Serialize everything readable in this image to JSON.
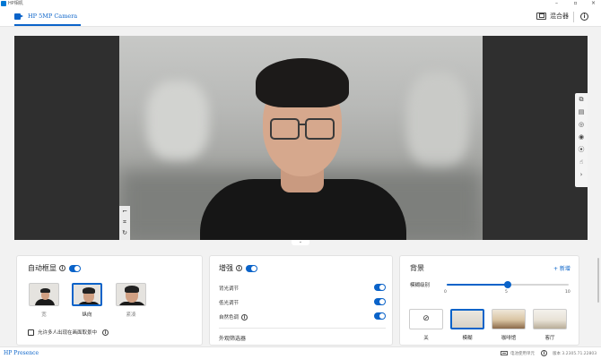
{
  "window": {
    "title": "HP相机"
  },
  "header": {
    "camera_tab": "HP 5MP Camera",
    "mixer_label": "混合器"
  },
  "preview": {
    "left_tools": [
      "⌐",
      "⌗",
      "↻"
    ],
    "right_tools": [
      "⧉",
      "▤",
      "◎",
      "◉",
      "⦿",
      "☝",
      "›"
    ]
  },
  "autoframe": {
    "title": "自动框显",
    "enabled": true,
    "options": [
      {
        "label": "宽",
        "selected": false
      },
      {
        "label": "纵向",
        "selected": true
      },
      {
        "label": "紧凑",
        "selected": false
      }
    ],
    "checkbox_label": "允许多人出现在画面取景中"
  },
  "enhance": {
    "title": "增强",
    "enabled": true,
    "rows": [
      {
        "label": "背光调节",
        "on": true
      },
      {
        "label": "低光调节",
        "on": true
      },
      {
        "label": "自然色调",
        "on": true,
        "info": true
      }
    ],
    "filter_label": "外观筛选器"
  },
  "background": {
    "title": "背景",
    "add_label": "+ 新增",
    "blur_label": "模糊级别",
    "slider": {
      "min": "0",
      "mid": "5",
      "max": "10",
      "value": 5
    },
    "options": [
      {
        "label": "关",
        "selected": false
      },
      {
        "label": "模糊",
        "selected": true
      },
      {
        "label": "咖啡馆",
        "selected": false
      },
      {
        "label": "客厅",
        "selected": false
      }
    ]
  },
  "status": {
    "brand": "HP Presence",
    "battery_text": "电池使用单元",
    "version": "版本 3.2305.71.22803"
  }
}
